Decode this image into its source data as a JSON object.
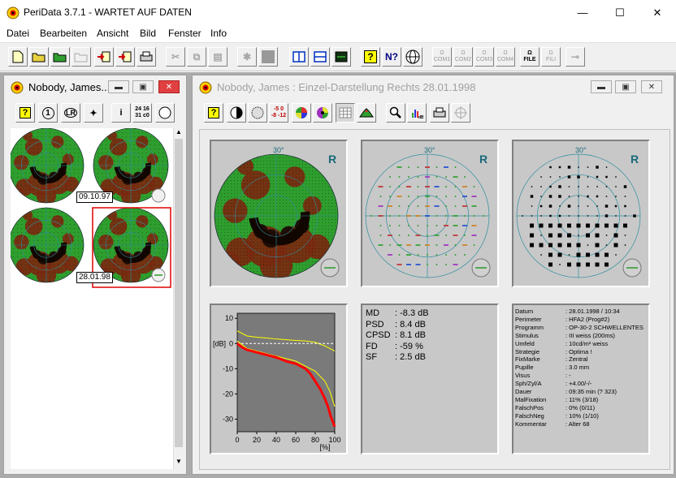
{
  "app": {
    "title": "PeriData 3.7.1 - WARTET AUF DATEN",
    "controls": {
      "minimize": "—",
      "maximize": "☐",
      "close": "✕"
    }
  },
  "menu": [
    "Datei",
    "Bearbeiten",
    "Ansicht",
    "Bild",
    "Fenster",
    "Info"
  ],
  "toolbar_extra": {
    "com1": "COM1",
    "com2": "COM2",
    "com3": "COM3",
    "com4": "COM4",
    "file": "FILE",
    "fili": "FILI"
  },
  "left_window": {
    "title": "Nobody, James...",
    "toolbar_icons": [
      "help-icon",
      "circle-1-icon",
      "l-r-icon",
      "wand-icon",
      "info-icon",
      "numbers-icon",
      "moon-icon"
    ],
    "numbers_label": {
      "top": "24 16",
      "bottom": "31 c0"
    },
    "exam_dates": [
      "09.10.97",
      "28.01.98"
    ]
  },
  "right_window": {
    "title": "Nobody, James  :  Einzel-Darstellung  Rechts  28.01.1998",
    "toolbar_icons": [
      "help-icon",
      "half-circle-icon",
      "dot-circle-icon",
      "values-icon",
      "color-wheel-icon",
      "color-wheel2-icon",
      "grid-icon",
      "hill-icon",
      "zoom-icon",
      "db-bar-icon",
      "print-icon",
      "crosshair-icon"
    ],
    "values_label": {
      "top": "-5 0",
      "bottom": "-8 -12"
    },
    "angle_label": "30°",
    "eye_label": "R",
    "stats": [
      {
        "key": "MD",
        "value": "-8.3 dB"
      },
      {
        "key": "PSD",
        "value": "8.4 dB"
      },
      {
        "key": "CPSD",
        "value": "8.1 dB"
      },
      {
        "key": "FD",
        "value": "-59 %"
      },
      {
        "key": "SF",
        "value": "2.5 dB"
      }
    ],
    "info": [
      {
        "key": "Datum",
        "value": "28.01.1998 / 10:34"
      },
      {
        "key": "Perimeter",
        "value": "HFA2  (Prog#2)"
      },
      {
        "key": "Programm",
        "value": "OP-30-2 SCHWELLENTES"
      },
      {
        "key": "Stimulus",
        "value": "III weiss (200ms)"
      },
      {
        "key": "Umfeld",
        "value": "10cd/m² weiss"
      },
      {
        "key": "Strategie",
        "value": "Optima !"
      },
      {
        "key": "FixMarke",
        "value": "Zentral"
      },
      {
        "key": "Pupille",
        "value": "3.0 mm"
      },
      {
        "key": "Visus",
        "value": "-"
      },
      {
        "key": "Sph/Zyl/A",
        "value": "+4.00/-/-"
      },
      {
        "key": "Dauer",
        "value": "09:35 min  (? 323)"
      },
      {
        "key": "MalFixation",
        "value": "11% (3/18)"
      },
      {
        "key": "FalschPos",
        "value": "0% (0/11)"
      },
      {
        "key": "FalschNeg",
        "value": "10% (1/10)"
      },
      {
        "key": "Kommentar",
        "value": "Alter 68"
      }
    ]
  },
  "chart_data": {
    "type": "line",
    "ylabel": "[dB]",
    "xlabel": "[%]",
    "xlim": [
      0,
      100
    ],
    "ylim": [
      -35,
      12
    ],
    "x_ticks": [
      0,
      20,
      40,
      60,
      80,
      100
    ],
    "y_ticks": [
      10,
      0,
      -10,
      -20,
      -30
    ],
    "series": [
      {
        "color": "#ffff00",
        "x": [
          0,
          10,
          20,
          30,
          40,
          50,
          60,
          70,
          80,
          90,
          95,
          100
        ],
        "y": [
          5,
          3,
          2.5,
          2.2,
          1.8,
          1.5,
          1.2,
          1,
          0.5,
          -1,
          -2,
          -3
        ]
      },
      {
        "color": "#ffff00",
        "x": [
          0,
          10,
          20,
          30,
          40,
          50,
          60,
          70,
          80,
          90,
          95,
          100
        ],
        "y": [
          1,
          -2,
          -3,
          -4,
          -5,
          -6,
          -7,
          -9,
          -11,
          -15,
          -19,
          -25
        ]
      },
      {
        "color": "#ffffff",
        "x": [
          0,
          100
        ],
        "y": [
          0,
          0
        ]
      },
      {
        "color": "#ff0000",
        "x": [
          0,
          5,
          10,
          15,
          20,
          30,
          40,
          50,
          60,
          70,
          75,
          80,
          85,
          90,
          93,
          96,
          100
        ],
        "y": [
          0,
          -1.5,
          -2.5,
          -3,
          -3.5,
          -4.5,
          -5.5,
          -7,
          -8,
          -10,
          -12,
          -15,
          -18,
          -22,
          -25,
          -29,
          -33
        ]
      }
    ]
  },
  "colors": {
    "field_green": "#2e9e2e",
    "field_brown": "#7a2a10",
    "panel_grey": "#c8c8c8",
    "selection_red": "#e00000",
    "grid_teal": "#2f8f8f"
  }
}
